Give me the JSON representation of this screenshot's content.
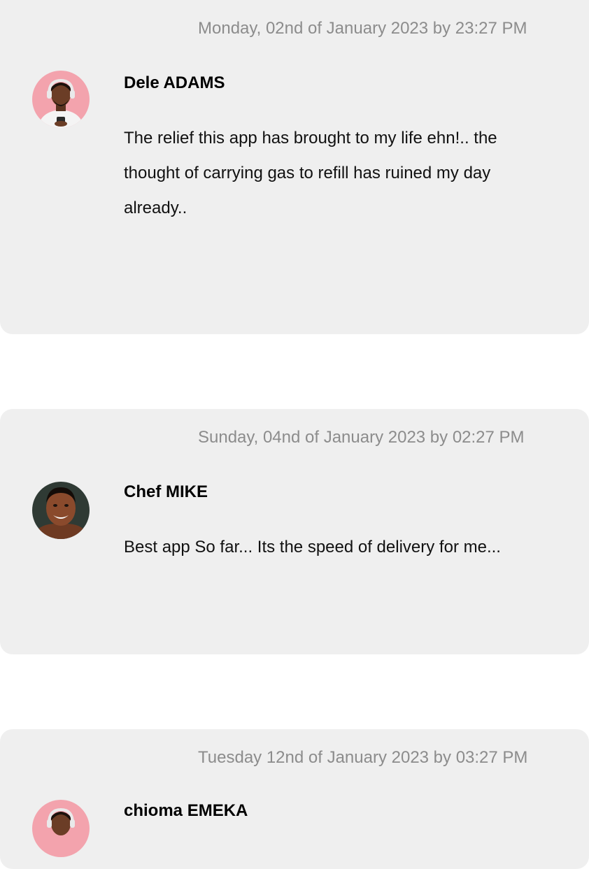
{
  "reviews": [
    {
      "date": "Monday, 02nd of January 2023 by 23:27 PM",
      "author": "Dele ADAMS",
      "text": "The relief this app has brought to my life ehn!.. the thought of carrying gas to refill has ruined my day already..",
      "avatar_bg": "#f3a3ad"
    },
    {
      "date": "Sunday, 04nd of January 2023 by 02:27 PM",
      "author": "Chef  MIKE",
      "text": "Best app So far... Its the speed of delivery for me...",
      "avatar_bg": "#2f3a34"
    },
    {
      "date": "Tuesday 12nd of January 2023 by 03:27 PM",
      "author": "chioma  EMEKA",
      "text": "",
      "avatar_bg": "#f3a3ad"
    }
  ]
}
